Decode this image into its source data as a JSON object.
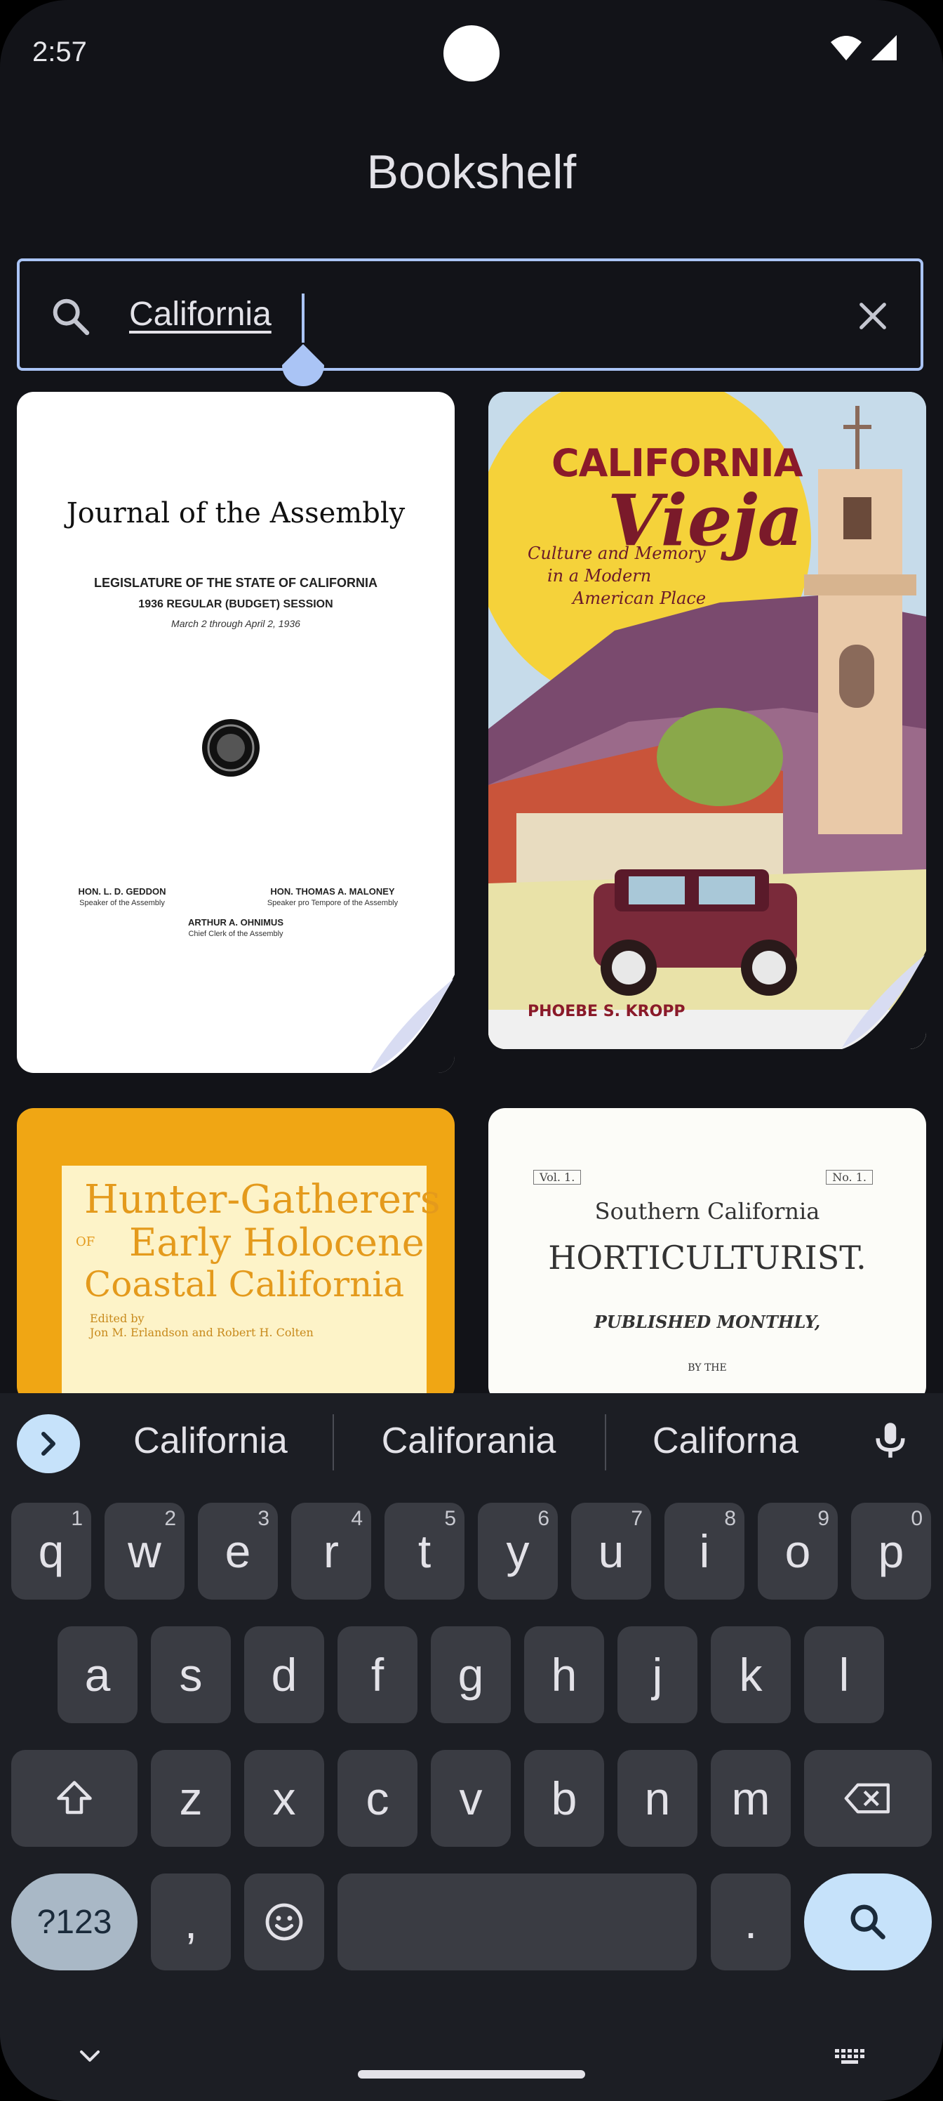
{
  "status": {
    "time": "2:57"
  },
  "app": {
    "title": "Bookshelf"
  },
  "search": {
    "value": "California"
  },
  "books": [
    {
      "title": "Journal of the Assembly",
      "line1": "LEGISLATURE OF THE STATE OF CALIFORNIA",
      "line2": "1936 REGULAR (BUDGET) SESSION",
      "line3": "March 2 through April 2, 1936",
      "left_name": "HON. L. D. GEDDON",
      "left_role": "Speaker of the Assembly",
      "right_name": "HON. THOMAS A. MALONEY",
      "right_role": "Speaker pro Tempore of the Assembly",
      "clerk_name": "ARTHUR A. OHNIMUS",
      "clerk_role": "Chief Clerk of the Assembly"
    },
    {
      "title_top": "CALIFORNIA",
      "title_script": "Vieja",
      "subtitle_1": "Culture and Memory",
      "subtitle_2": "in a Modern",
      "subtitle_3": "American Place",
      "author": "PHOEBE S. KROPP"
    },
    {
      "title_1": "Hunter-Gatherers",
      "title_2_prefix": "OF",
      "title_2": "Early Holocene",
      "title_3": "Coastal California",
      "editors_1": "Edited by",
      "editors_2": "Jon M. Erlandson and Robert H. Colten"
    },
    {
      "vol": "Vol. 1.",
      "no": "No. 1.",
      "title_1": "Southern California",
      "title_2": "HORTICULTURIST.",
      "title_3": "PUBLISHED MONTHLY,",
      "title_4": "BY THE"
    }
  ],
  "keyboard": {
    "suggestions": [
      "California",
      "Califorania",
      "Californa"
    ],
    "row1": [
      {
        "k": "q",
        "h": "1"
      },
      {
        "k": "w",
        "h": "2"
      },
      {
        "k": "e",
        "h": "3"
      },
      {
        "k": "r",
        "h": "4"
      },
      {
        "k": "t",
        "h": "5"
      },
      {
        "k": "y",
        "h": "6"
      },
      {
        "k": "u",
        "h": "7"
      },
      {
        "k": "i",
        "h": "8"
      },
      {
        "k": "o",
        "h": "9"
      },
      {
        "k": "p",
        "h": "0"
      }
    ],
    "row2": [
      "a",
      "s",
      "d",
      "f",
      "g",
      "h",
      "j",
      "k",
      "l"
    ],
    "row3": [
      "z",
      "x",
      "c",
      "v",
      "b",
      "n",
      "m"
    ],
    "symbols_label": "?123",
    "comma": ",",
    "period": "."
  }
}
